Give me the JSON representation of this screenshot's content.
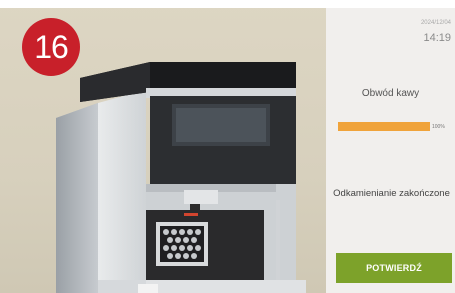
{
  "step_badge": "16",
  "status_bar": {
    "date": "2024/12/04",
    "time": "14:19"
  },
  "coffee_circuit": {
    "title": "Obwód kawy",
    "progress_percent": 100,
    "progress_label": "100%"
  },
  "status_message": "Odkamienianie zakończone",
  "confirm_button": {
    "label": "POTWIERDŹ"
  },
  "colors": {
    "progress": "#f0a33a",
    "confirm": "#7da22a",
    "badge": "#c8202a"
  }
}
